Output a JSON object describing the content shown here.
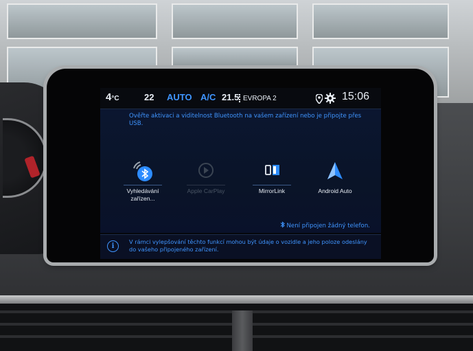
{
  "status_bar": {
    "outside_temp": "4",
    "outside_temp_unit": "°C",
    "fan_or_temp_left": "22",
    "climate_mode": "AUTO",
    "ac": "A/C",
    "radio_frequency": "21.5",
    "radio_station": "EVROPA 2",
    "clock": "15:06"
  },
  "message": "Ověřte aktivaci a viditelnost Bluetooth na vašem zařízení nebo je připojte přes USB.",
  "apps": [
    {
      "label": "Vyhledávání zařízen...",
      "icon": "bluetooth-search-icon",
      "enabled": true
    },
    {
      "label": "Apple CarPlay",
      "icon": "apple-carplay-icon",
      "enabled": false
    },
    {
      "label": "MirrorLink",
      "icon": "mirrorlink-icon",
      "enabled": true
    },
    {
      "label": "Android Auto",
      "icon": "android-auto-icon",
      "enabled": true
    }
  ],
  "bluetooth_status": "Není připojen žádný telefon.",
  "info_text": "V rámci vylepšování těchto funkcí mohou být údaje o vozidle a jeho poloze odeslány do vašeho připojeného zařízení.",
  "colors": {
    "accent_blue": "#3f95ff",
    "screen_bg": "#0b1630",
    "android_auto_blue": "#2d8cff"
  }
}
